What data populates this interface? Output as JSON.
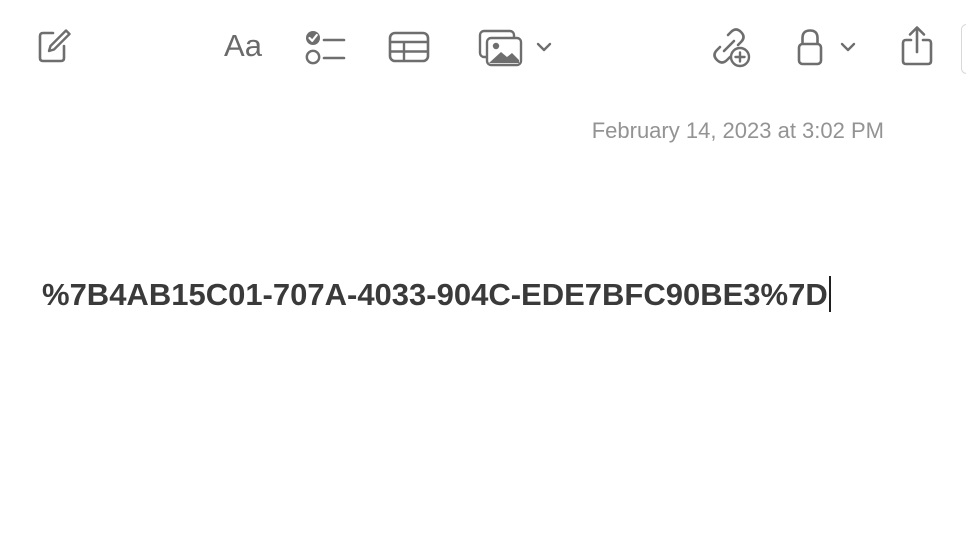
{
  "toolbar": {
    "compose_icon": "compose-icon",
    "format_label": "Aa",
    "checklist_icon": "checklist-icon",
    "table_icon": "table-icon",
    "media_icon": "photo-icon",
    "collaborate_icon": "link-add-icon",
    "lock_icon": "lock-icon",
    "share_icon": "share-icon"
  },
  "note": {
    "date": "February 14, 2023 at 3:02 PM",
    "body": "%7B4AB15C01-707A-4033-904C-EDE7BFC90BE3%7D"
  },
  "colors": {
    "icon": "#6e6e6e",
    "date_text": "#939393",
    "body_text": "#3a3a3a"
  }
}
